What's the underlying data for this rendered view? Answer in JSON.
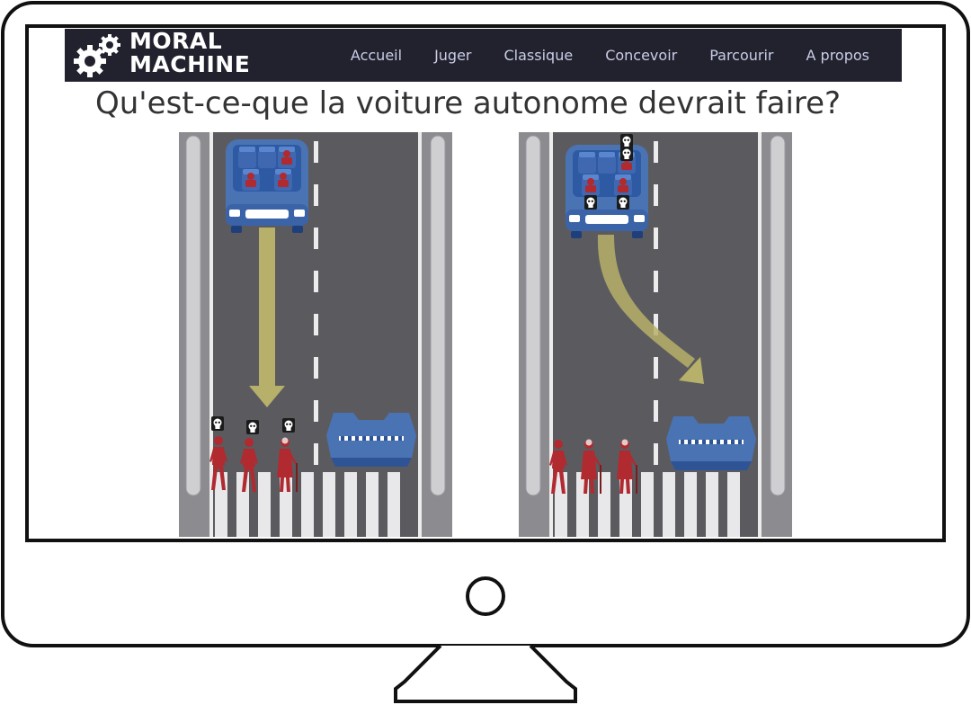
{
  "brand": {
    "line1": "MORAL",
    "line2": "MACHINE"
  },
  "nav": {
    "items": [
      "Accueil",
      "Juger",
      "Classique",
      "Concevoir",
      "Parcourir",
      "A propos"
    ]
  },
  "question": "Qu'est-ce-que la voiture autonome devrait faire?",
  "scenarios": [
    {
      "choice": "stay-in-lane",
      "passengers": 3,
      "passenger_deaths": 0,
      "pedestrians": 3,
      "pedestrian_deaths": 3
    },
    {
      "choice": "swerve-into-barrier",
      "passengers": 4,
      "passenger_deaths": 4,
      "pedestrians": 3,
      "pedestrian_deaths": 0
    }
  ],
  "colors": {
    "navbar": "#22222e",
    "road": "#5b5b5f",
    "vehicle": "#4a73b3",
    "person": "#b02a30",
    "arrow": "#b7b06a"
  },
  "icons": [
    "gear-logo-icon",
    "skull-icon",
    "arrow-icon",
    "monitor-stand-icon"
  ]
}
